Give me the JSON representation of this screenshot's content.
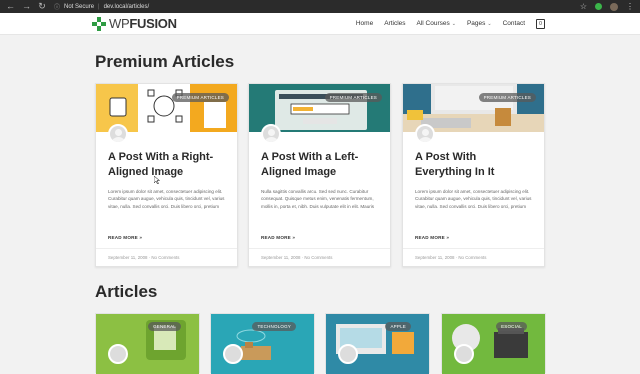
{
  "browser": {
    "security_label": "Not Secure",
    "url": "dev.local/articles/"
  },
  "header": {
    "logo_wp": "WP",
    "logo_fusion": "FUSION",
    "menu": [
      {
        "label": "Home"
      },
      {
        "label": "Articles"
      },
      {
        "label": "All Courses"
      },
      {
        "label": "Pages"
      },
      {
        "label": "Contact"
      }
    ],
    "cart_count": "0"
  },
  "premium": {
    "title": "Premium Articles",
    "cards": [
      {
        "tag": "PREMIUM ARTICLES",
        "title": "A Post With a Right-Aligned Image",
        "excerpt": "Lorem ipsum dolor sit amet, consectetuer adipiscing elit. Curabitur quam augue, vehicula quis, tincidunt vel, varius vitae, nulla. Sed convallis orci. Duis libero orci, pretium",
        "more": "READ MORE »",
        "date": "September 11, 2008",
        "comments": "No Comments"
      },
      {
        "tag": "PREMIUM ARTICLES",
        "title": "A Post With a Left-Aligned Image",
        "excerpt": "Nulla sagittis convallis arcu. Sed sed nunc. Curabitur consequat. Quisque metus enim, venenatis fermentum, mollis in, porta et, nibh. Duis vulputate elit in elit. Mauris",
        "more": "READ MORE »",
        "date": "September 11, 2008",
        "comments": "No Comments"
      },
      {
        "tag": "PREMIUM ARTICLES",
        "title": "A Post With Everything In It",
        "excerpt": "Lorem ipsum dolor sit amet, consectetuer adipiscing elit. Curabitur quam augue, vehicula quis, tincidunt vel, varius vitae, nulla. Sed convallis orci. Duis libero orci, pretium",
        "more": "READ MORE »",
        "date": "September 11, 2008",
        "comments": "No Comments"
      }
    ]
  },
  "articles": {
    "title": "Articles",
    "cards": [
      {
        "tag": "GENERAL"
      },
      {
        "tag": "TECHNOLOGY"
      },
      {
        "tag": "APPLE"
      },
      {
        "tag": "ESOCIAL"
      }
    ]
  },
  "colors": {
    "brand_green": "#2e9c43",
    "background": "#f2f2f2"
  }
}
